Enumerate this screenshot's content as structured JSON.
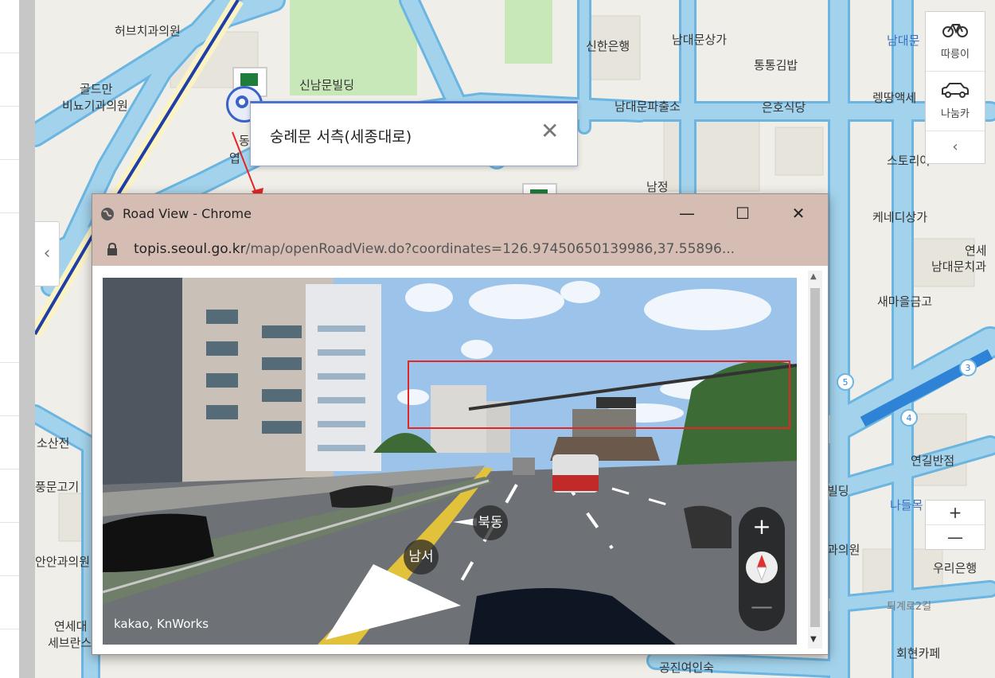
{
  "map": {
    "labels": {
      "herb": "허브치과의원",
      "goldman_1": "골드만",
      "goldman_2": "비뇨기과의원",
      "sinnam": "신남문빌딩",
      "shinhan": "신한은행",
      "namdae_market": "남대문상가",
      "tongtong": "통통김밥",
      "namdae_police": "남대문파출소",
      "eunho": "은호식당",
      "rengttang": "렝땅액세",
      "storia": "스토리아",
      "namjeong": "남정",
      "kennedy": "케네디상가",
      "yonsei_1": "연세",
      "yonsei_2": "남대문치과",
      "saemaeul": "새마을금고",
      "yeongil": "연길반점",
      "nadeul": "나들목",
      "woori": "우리은행",
      "toegye": "퇴계로2길",
      "hoehyeon": "회현카페",
      "gongjin": "공진여인숙",
      "san": "소산전",
      "pungmun": "풍문고기",
      "anan": "안안과의원",
      "yonsei_sev_1": "연세대",
      "yonsei_sev_2": "세브란스",
      "namdaemun_top": "남대문",
      "building": "빌딩",
      "uiwon": "과의원",
      "dong": "동",
      "yeop": "엽"
    }
  },
  "side_tools": {
    "bike": "따릉이",
    "car": "나눔카",
    "collapse": "‹"
  },
  "zoom": {
    "in": "+",
    "out": "—"
  },
  "panel_toggle": "‹",
  "popup": {
    "title": "숭례문 서측(세종대로)",
    "close": "✕"
  },
  "window": {
    "title": "Road View - Chrome",
    "url_host": "topis.seoul.go.kr",
    "url_path": "/map/openRoadView.do?coordinates=126.97450650139986,37.55896...",
    "minimize": "—",
    "maximize": "☐",
    "close": "✕"
  },
  "roadview": {
    "dir_north": "북동",
    "dir_south": "남서",
    "credit": "kakao, KnWorks",
    "zoom_in": "+",
    "zoom_out": "—"
  },
  "colors": {
    "road": "#a3d3ec",
    "road_outline": "#6bb5e0",
    "highlight": "#e52525",
    "popup_accent": "#4a74c9"
  }
}
